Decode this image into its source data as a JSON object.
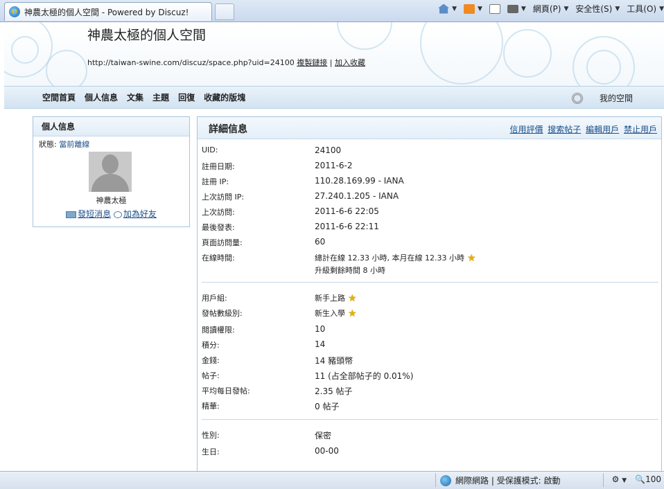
{
  "browser": {
    "tab_title": "神農太極的個人空間 - Powered by Discuz!",
    "toolbar": {
      "page_menu": "網頁(P)",
      "safety_menu": "安全性(S)",
      "tools_menu": "工具(O)"
    },
    "statusbar": {
      "zone_text": "網際網路 | 受保護模式: 啟動",
      "zoom_text": "100"
    }
  },
  "header": {
    "title": "神農太極的個人空間",
    "url": "http://taiwan-swine.com/discuz/space.php?uid=24100",
    "copy_link": "複製鏈接",
    "separator": "|",
    "add_favorite": "加入收藏"
  },
  "nav": {
    "items": [
      "空間首頁",
      "個人信息",
      "文集",
      "主題",
      "回復",
      "收藏的版塊"
    ],
    "my_space": "我的空間"
  },
  "profile": {
    "heading": "個人信息",
    "status_label": "狀態:",
    "status_value": "當前離線",
    "username": "神農太極",
    "send_message": "發短消息",
    "add_friend": "加為好友"
  },
  "detail": {
    "heading": "詳細信息",
    "links": [
      "信用評價",
      "搜索帖子",
      "編輯用戶",
      "禁止用戶"
    ],
    "section1": [
      {
        "key": "UID:",
        "value": "24100"
      },
      {
        "key": "註冊日期:",
        "value": "2011-6-2"
      },
      {
        "key": "註冊 IP:",
        "value": "110.28.169.99 - IANA"
      },
      {
        "key": "上次訪問 IP:",
        "value": "27.240.1.205 - IANA"
      },
      {
        "key": "上次訪問:",
        "value": "2011-6-6 22:05"
      },
      {
        "key": "最後發表:",
        "value": "2011-6-6 22:11"
      },
      {
        "key": "頁面訪問量:",
        "value": "60"
      }
    ],
    "online": {
      "key": "在線時間:",
      "value": "總計在線 12.33 小時, 本月在線 12.33 小時",
      "sub": "升級剩餘時間 8 小時"
    },
    "section2": [
      {
        "key": "用戶組:",
        "value": "新手上路",
        "star": true
      },
      {
        "key": "發帖數級別:",
        "value": "新生入學",
        "star": true
      },
      {
        "key": "閱讀權限:",
        "value": "10"
      },
      {
        "key": "積分:",
        "value": "14"
      },
      {
        "key": "金錢:",
        "value": "14 豬頭幣"
      },
      {
        "key": "帖子:",
        "value": "11 (占全部帖子的 0.01%)"
      },
      {
        "key": "平均每日發帖:",
        "value": "2.35 帖子"
      },
      {
        "key": "精華:",
        "value": "0 帖子"
      }
    ],
    "section3": [
      {
        "key": "性別:",
        "value": "保密"
      },
      {
        "key": "生日:",
        "value": "00-00"
      }
    ]
  }
}
